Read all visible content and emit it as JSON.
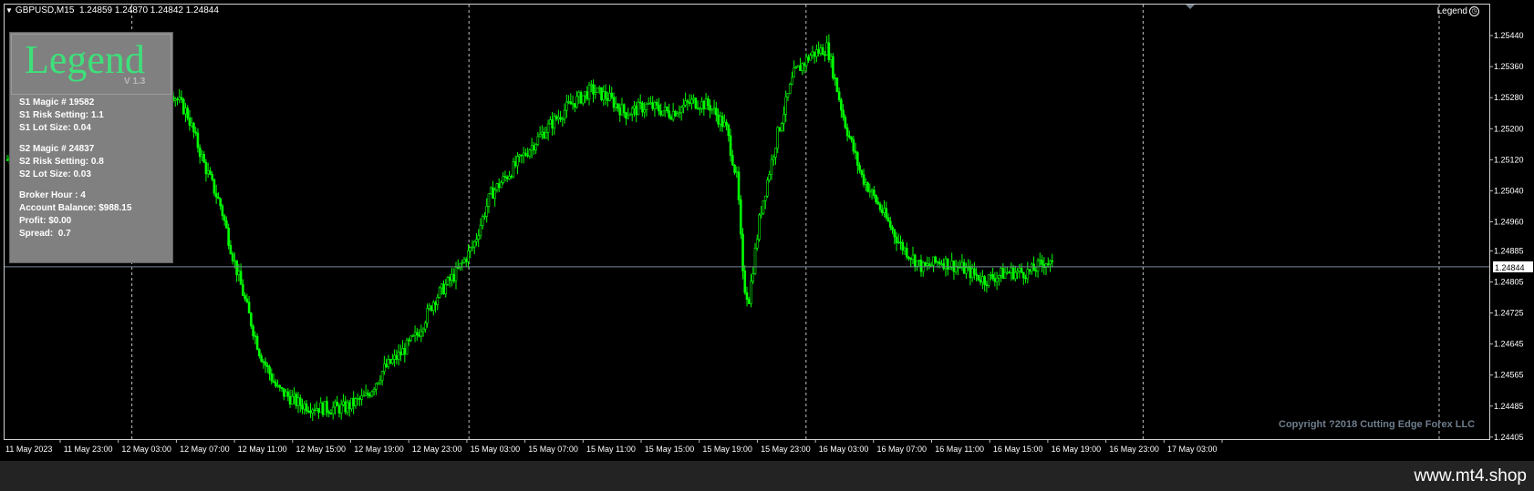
{
  "header": {
    "symbol": "GBPUSD,M15",
    "ohlc": "1.24859 1.24870 1.24842 1.24844"
  },
  "legend_toggle": {
    "label": "Legend"
  },
  "legend_panel": {
    "title": "Legend",
    "version": "V 1.3",
    "s1_magic": "S1 Magic # 19582",
    "s1_risk": "S1 Risk Setting: 1.1",
    "s1_lot": "S1 Lot Size: 0.04",
    "s2_magic": "S2 Magic # 24837",
    "s2_risk": "S2 Risk Setting: 0.8",
    "s2_lot": "S2 Lot Size: 0.03",
    "broker_hour": "Broker Hour : 4",
    "balance": "Account Balance: $988.15",
    "profit": "Profit: $0.00",
    "spread": "Spread:  0.7"
  },
  "copyright": "Copyright ?2018 Cutting Edge Forex LLC",
  "footer_url": "www.mt4.shop",
  "colors": {
    "candle": "#00ff00",
    "bid_line": "#778899",
    "grid": "#c0c0c0",
    "legend_title": "#3ee07a"
  },
  "chart_data": {
    "type": "line",
    "title": "GBPUSD,M15",
    "current_price": "1.24844",
    "current_price_value": 1.24844,
    "ylim": [
      1.244,
      1.2552
    ],
    "y_ticks": [
      "1.25440",
      "1.25360",
      "1.25280",
      "1.25200",
      "1.25120",
      "1.25040",
      "1.24960",
      "1.24885",
      "1.24805",
      "1.24725",
      "1.24645",
      "1.24565",
      "1.24485",
      "1.24405"
    ],
    "x_ticks": [
      "11 May 2023",
      "11 May 23:00",
      "12 May 03:00",
      "12 May 07:00",
      "12 May 11:00",
      "12 May 15:00",
      "12 May 19:00",
      "12 May 23:00",
      "15 May 03:00",
      "15 May 07:00",
      "15 May 11:00",
      "15 May 15:00",
      "15 May 19:00",
      "15 May 23:00",
      "16 May 03:00",
      "16 May 07:00",
      "16 May 11:00",
      "16 May 15:00",
      "16 May 19:00",
      "16 May 23:00",
      "17 May 03:00"
    ],
    "close_path": [
      [
        0,
        1.2512
      ],
      [
        0.1,
        1.2516
      ],
      [
        0.3,
        1.2519
      ],
      [
        0.6,
        1.252
      ],
      [
        1.0,
        1.2522
      ],
      [
        1.4,
        1.2523
      ],
      [
        1.7,
        1.2526
      ],
      [
        2.0,
        1.2531
      ],
      [
        2.2,
        1.2527
      ],
      [
        2.5,
        1.2529
      ],
      [
        2.8,
        1.2532
      ],
      [
        3.2,
        1.2524
      ],
      [
        3.5,
        1.2511
      ],
      [
        3.8,
        1.25
      ],
      [
        4.0,
        1.2488
      ],
      [
        4.3,
        1.2472
      ],
      [
        4.5,
        1.2462
      ],
      [
        4.8,
        1.2453
      ],
      [
        5.2,
        1.2449
      ],
      [
        5.6,
        1.2448
      ],
      [
        6.0,
        1.2448
      ],
      [
        6.4,
        1.2451
      ],
      [
        6.7,
        1.2458
      ],
      [
        7.0,
        1.2462
      ],
      [
        7.3,
        1.2467
      ],
      [
        7.6,
        1.2476
      ],
      [
        8.0,
        1.2483
      ],
      [
        8.3,
        1.249
      ],
      [
        8.6,
        1.2503
      ],
      [
        8.9,
        1.2508
      ],
      [
        9.3,
        1.2515
      ],
      [
        9.6,
        1.252
      ],
      [
        10.0,
        1.2526
      ],
      [
        10.4,
        1.253
      ],
      [
        10.7,
        1.2528
      ],
      [
        11.0,
        1.2524
      ],
      [
        11.4,
        1.2526
      ],
      [
        11.8,
        1.2524
      ],
      [
        12.2,
        1.2527
      ],
      [
        12.5,
        1.2526
      ],
      [
        12.8,
        1.252
      ],
      [
        13.0,
        1.2506
      ],
      [
        13.1,
        1.248
      ],
      [
        13.2,
        1.2476
      ],
      [
        13.4,
        1.2498
      ],
      [
        13.7,
        1.2518
      ],
      [
        14.0,
        1.2534
      ],
      [
        14.3,
        1.2539
      ],
      [
        14.6,
        1.2541
      ],
      [
        14.9,
        1.2522
      ],
      [
        15.2,
        1.2508
      ],
      [
        15.6,
        1.2498
      ],
      [
        15.9,
        1.249
      ],
      [
        16.3,
        1.2484
      ],
      [
        16.6,
        1.2486
      ],
      [
        17.0,
        1.2484
      ],
      [
        17.4,
        1.2481
      ],
      [
        17.8,
        1.2483
      ],
      [
        18.2,
        1.2483
      ],
      [
        18.5,
        1.2486
      ],
      [
        18.6,
        1.24844
      ]
    ]
  }
}
